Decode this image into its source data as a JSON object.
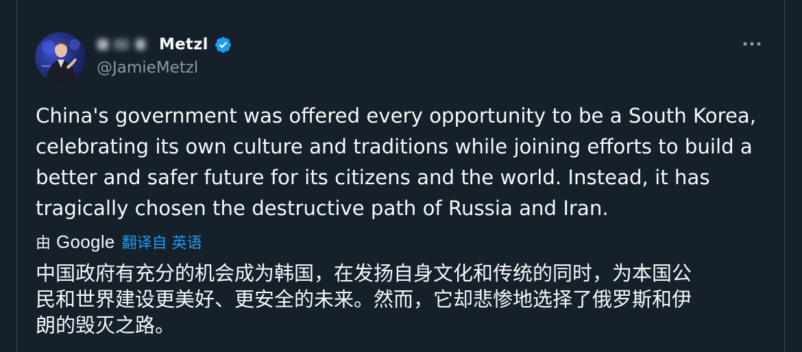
{
  "tweet": {
    "author": {
      "display_name_visible": "Metzl",
      "handle": "@JamieMetzl",
      "verified": true,
      "avatar_icon": "person-speaking-portrait"
    },
    "more_icon": "ellipsis-icon",
    "text_lines": [
      "China's government was offered every opportunity to be a South Korea,",
      "celebrating its own culture and traditions while joining efforts to build a",
      "better and safer future for its citizens and the world. Instead, it has",
      "tragically chosen the destructive path of Russia and Iran."
    ],
    "translation": {
      "by_label": "由",
      "provider": "Google",
      "link_label": "翻译自 英语",
      "text_lines": [
        "中国政府有充分的机会成为韩国，在发扬自身文化和传统的同时，为本国公",
        "民和世界建设更美好、更安全的未来。然而，它却悲惨地选择了俄罗斯和伊",
        "朗的毁灭之路。"
      ]
    }
  },
  "colors": {
    "background": "#15202b",
    "text": "#f7f9f9",
    "secondary": "#8b98a5",
    "accent": "#1d9bf0",
    "border": "#38444d"
  }
}
